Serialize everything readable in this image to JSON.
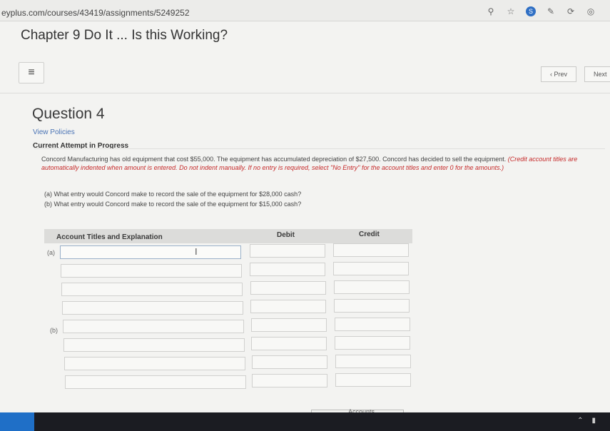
{
  "browser": {
    "url": "eyplus.com/courses/43419/assignments/5249252",
    "icons": [
      "search-icon",
      "star-icon",
      "extension-icon",
      "pen-icon",
      "refresh-icon",
      "profile-icon"
    ]
  },
  "header": {
    "chapter_title": "Chapter 9 Do It ... Is this Working?",
    "menu_icon": "≡",
    "prev_label": "‹ Prev",
    "next_label": "Next"
  },
  "question": {
    "title": "Question 4",
    "view_policies": "View Policies",
    "attempt_status": "Current Attempt in Progress",
    "problem_text": "Concord Manufacturing has old equipment that cost $55,000. The equipment has accumulated depreciation of $27,500. Concord has decided to sell the equipment. ",
    "instruction_text": "(Credit account titles are automatically indented when amount is entered. Do not indent manually. If no entry is required, select \"No Entry\" for the account titles and enter 0 for the amounts.)",
    "part_a": "(a)   What entry would Concord make to record the sale of the equipment for $28,000 cash?",
    "part_b": "(b)   What entry would Concord make to record the sale of the equipment for $15,000 cash?"
  },
  "table": {
    "headers": {
      "account": "Account Titles and Explanation",
      "debit": "Debit",
      "credit": "Credit"
    },
    "row_labels": [
      "(a)",
      "(b)"
    ]
  },
  "footer": {
    "accounts_tab": "Accounts"
  }
}
